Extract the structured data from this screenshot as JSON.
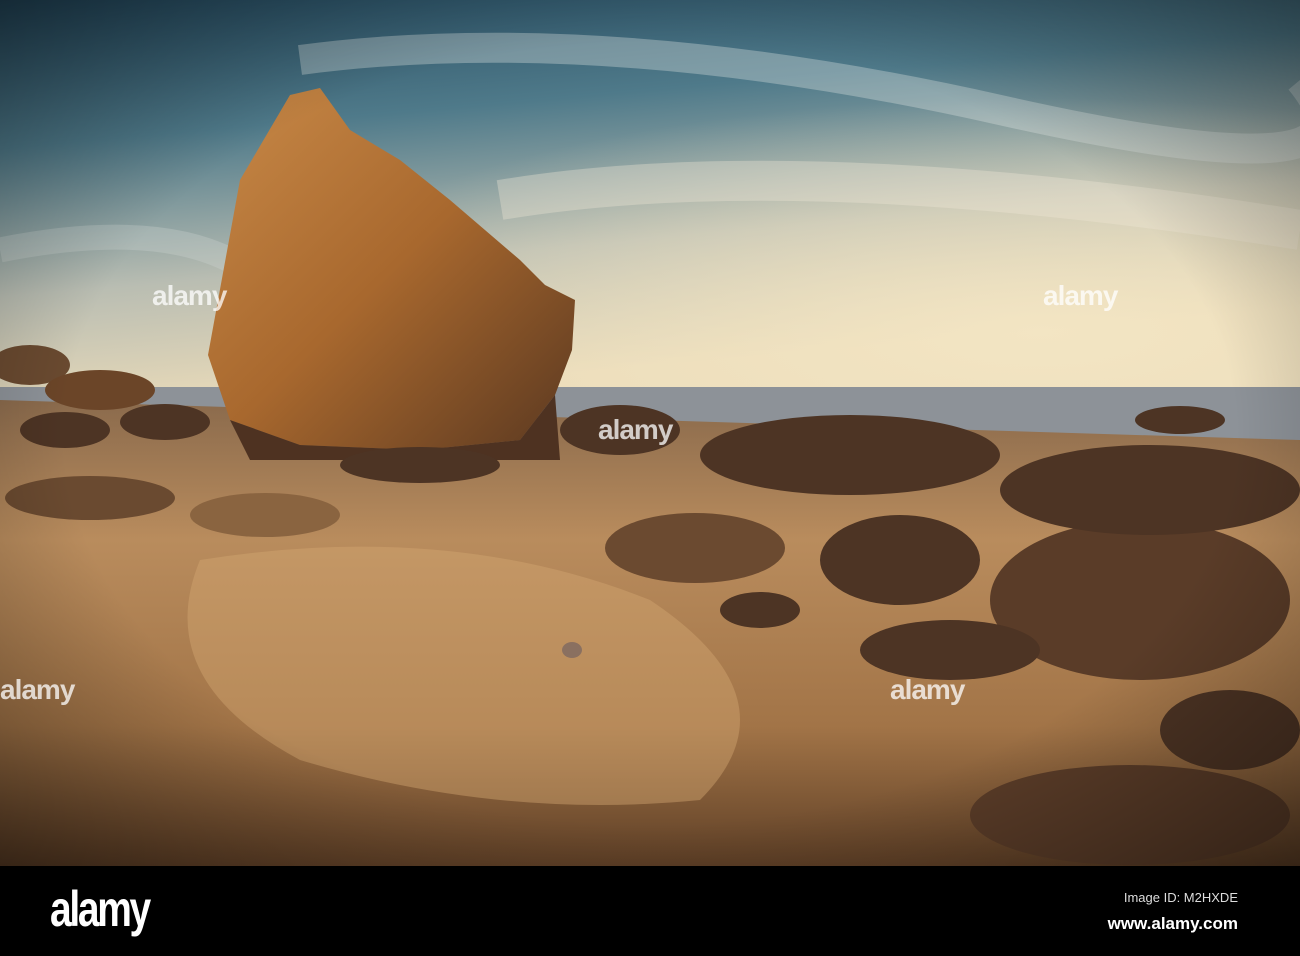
{
  "image": {
    "subject": "rocky beach at low tide",
    "colors": {
      "sky_top": "#2f5a6e",
      "sky_mid": "#8aa4ae",
      "horizon": "#e6d8b8",
      "sea": "#8a9098",
      "sand": "#b88a5a",
      "rock": "#a86a30",
      "rock_dark": "#4a3022"
    }
  },
  "watermark": {
    "text": "alamy"
  },
  "footer": {
    "logo": "alamy",
    "image_id": "Image ID: M2HXDE",
    "website": "www.alamy.com"
  }
}
